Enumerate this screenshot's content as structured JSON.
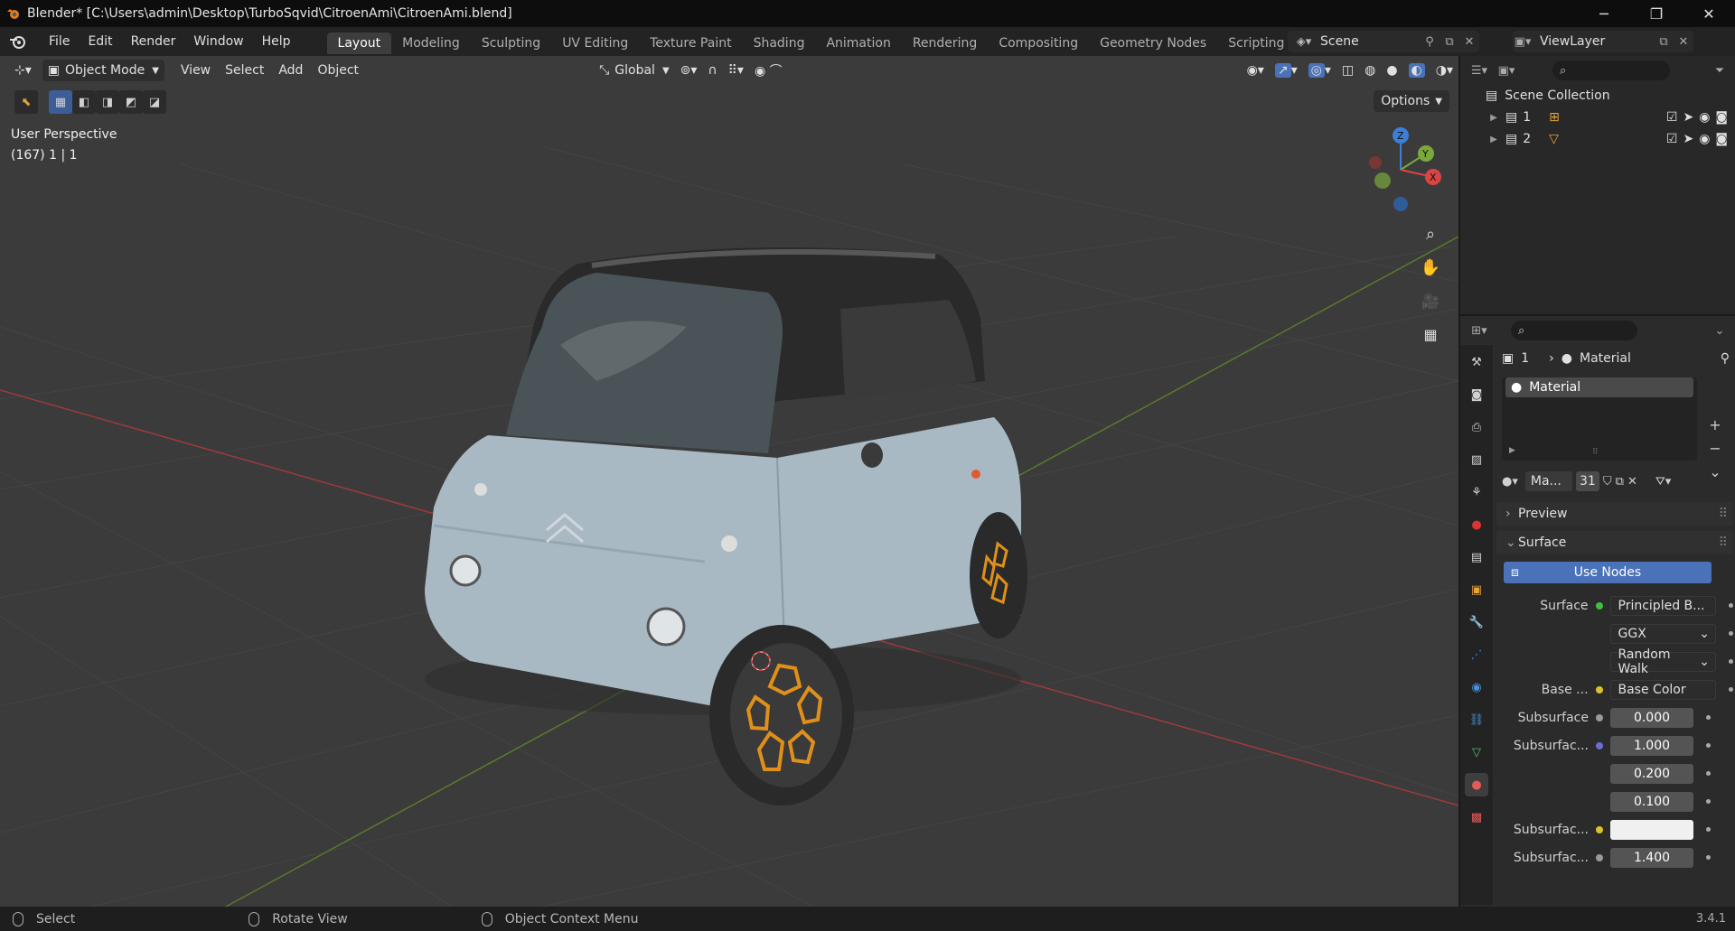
{
  "window": {
    "title": "Blender* [C:\\Users\\admin\\Desktop\\TurboSqvid\\CitroenAmi\\CitroenAmi.blend]",
    "minimize": "─",
    "maximize": "❐",
    "close": "✕"
  },
  "menu": [
    "File",
    "Edit",
    "Render",
    "Window",
    "Help"
  ],
  "workspaces": [
    "Layout",
    "Modeling",
    "Sculpting",
    "UV Editing",
    "Texture Paint",
    "Shading",
    "Animation",
    "Rendering",
    "Compositing",
    "Geometry Nodes",
    "Scripting"
  ],
  "active_workspace": "Layout",
  "scene": "Scene",
  "view_layer": "ViewLayer",
  "viewport": {
    "mode": "Object Mode",
    "menus": [
      "View",
      "Select",
      "Add",
      "Object"
    ],
    "transform_orientation": "Global",
    "options": "Options",
    "perspective": "User Perspective",
    "collection_info": "(167) 1 | 1"
  },
  "outliner": {
    "root": "Scene Collection",
    "items": [
      {
        "label": "1"
      },
      {
        "label": "2"
      }
    ]
  },
  "properties": {
    "breadcrumb_object": "1",
    "breadcrumb_material": "Material",
    "slot": "Material",
    "material_name": "Ma...",
    "users": "31",
    "preview_label": "Preview",
    "surface_label": "Surface",
    "use_nodes": "Use Nodes",
    "rows": [
      {
        "label": "Surface",
        "value": "Principled B...",
        "kind": "link",
        "dot": "#3fbf3f"
      },
      {
        "label": "",
        "value": "GGX",
        "kind": "drop"
      },
      {
        "label": "",
        "value": "Random Walk",
        "kind": "drop"
      },
      {
        "label": "Base ...",
        "value": "Base Color",
        "kind": "link",
        "dot": "#d9c22e"
      },
      {
        "label": "Subsurface",
        "value": "0.000",
        "kind": "num",
        "dot": "#9a9a9a"
      },
      {
        "label": "Subsurfac...",
        "value": "1.000",
        "kind": "num",
        "dot": "#6b6bd6"
      },
      {
        "label": "",
        "value": "0.200",
        "kind": "num"
      },
      {
        "label": "",
        "value": "0.100",
        "kind": "num"
      },
      {
        "label": "Subsurfac...",
        "value": "",
        "kind": "color",
        "dot": "#d9c22e"
      },
      {
        "label": "Subsurfac...",
        "value": "1.400",
        "kind": "num",
        "dot": "#9a9a9a"
      }
    ]
  },
  "status": {
    "select": "Select",
    "rotate": "Rotate View",
    "context": "Object Context Menu",
    "version": "3.4.1"
  },
  "gizmo": {
    "x": "X",
    "y": "Y",
    "z": "Z"
  }
}
